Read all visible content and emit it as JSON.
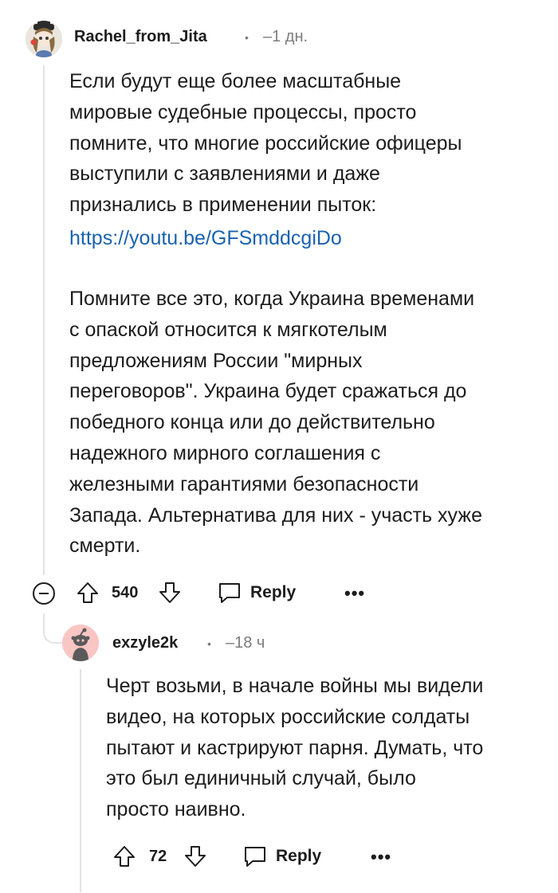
{
  "comment": {
    "username": "Rachel_from_Jita",
    "separator": "•",
    "time": "–1 дн.",
    "paragraph1": "Если будут еще более масштабные\nмировые судебные процессы, просто\nпомните, что многие российские офицеры\nвыступили с заявлениями и даже\nпризнались в применении пыток:",
    "link": "https://youtu.be/GFSmddcgiDo",
    "paragraph2": "Помните все это, когда Украина временами\nс опаской относится к мягкотелым\nпредложениям России \"мирных\nпереговоров\". Украина будет сражаться до\nпобедного конца или до действительно\nнадежного мирного соглашения с\nжелезными гарантиями безопасности\nЗапада. Альтернатива для них - участь хуже\nсмерти.",
    "votes": "540",
    "reply_label": "Reply",
    "more_label": "•••"
  },
  "reply": {
    "username": "exzyle2k",
    "separator": "•",
    "time": "–18 ч",
    "text": "Черт возьми, в начале войны мы видели\nвидео, на которых российские солдаты\nпытают и кастрируют парня. Думать, что\nэто был единичный случай, было\nпросто наивно.",
    "votes": "72",
    "reply_label": "Reply",
    "more_label": "•••"
  },
  "colors": {
    "link": "#1a62b0",
    "reply_avatar_bg": "#f9c6c4",
    "muted": "#7c7c7c"
  }
}
